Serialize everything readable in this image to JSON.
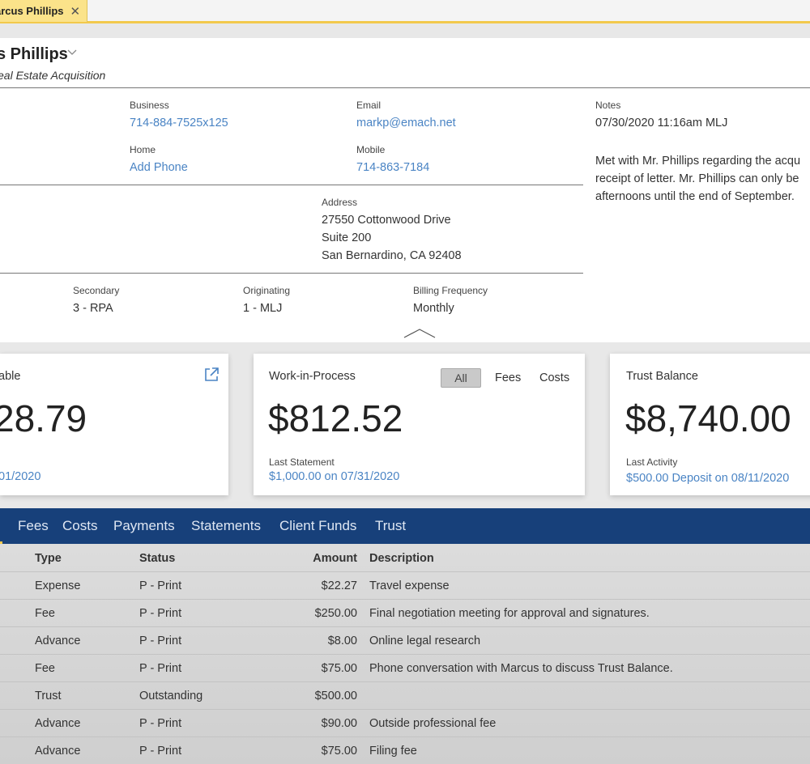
{
  "tab": {
    "label": "arcus Phillips",
    "close": "✕"
  },
  "client": {
    "name": "s Phillips",
    "matter": "eal Estate Acquisition"
  },
  "contact": {
    "business_label": "Business",
    "business_value": "714-884-7525x125",
    "home_label": "Home",
    "home_value": "Add Phone",
    "email_label": "Email",
    "email_value": "markp@emach.net",
    "mobile_label": "Mobile",
    "mobile_value": "714-863-7184",
    "address_label": "Address",
    "address_line1": "27550 Cottonwood Drive",
    "address_line2": "Suite 200",
    "address_line3": "San Bernardino, CA 92408"
  },
  "notes": {
    "label": "Notes",
    "timestamp": "07/30/2020 11:16am MLJ",
    "line1": "Met with Mr. Phillips regarding the acqu",
    "line2": "receipt of letter. Mr. Phillips can only be",
    "line3": "afternoons until the end of September."
  },
  "attorneys": {
    "secondary_label": "Secondary",
    "secondary_value": "3 - RPA",
    "originating_label": "Originating",
    "originating_value": "1 - MLJ",
    "billing_label": "Billing Frequency",
    "billing_value": "Monthly"
  },
  "cards": {
    "receivable": {
      "title": "able",
      "amount": "28.79",
      "link": "01/2020"
    },
    "wip": {
      "title": "Work-in-Process",
      "amount": "$812.52",
      "sublabel": "Last Statement",
      "link": "$1,000.00 on 07/31/2020",
      "seg_all": "All",
      "seg_fees": "Fees",
      "seg_costs": "Costs"
    },
    "trust": {
      "title": "Trust Balance",
      "amount": "$8,740.00",
      "sublabel": "Last Activity",
      "link": "$500.00 Deposit on 08/11/2020"
    }
  },
  "nav": {
    "items": [
      "Fees",
      "Costs",
      "Payments",
      "Statements",
      "Client Funds",
      "Trust"
    ]
  },
  "table": {
    "headers": {
      "type": "Type",
      "status": "Status",
      "amount": "Amount",
      "description": "Description"
    },
    "rows": [
      {
        "type": "Expense",
        "status": "P - Print",
        "amount": "$22.27",
        "description": "Travel expense"
      },
      {
        "type": "Fee",
        "status": "P - Print",
        "amount": "$250.00",
        "description": "Final negotiation meeting for approval and signatures."
      },
      {
        "type": "Advance",
        "status": "P - Print",
        "amount": "$8.00",
        "description": "Online legal research"
      },
      {
        "type": "Fee",
        "status": "P - Print",
        "amount": "$75.00",
        "description": "Phone conversation with Marcus to discuss Trust Balance."
      },
      {
        "type": "Trust",
        "status": "Outstanding",
        "amount": "$500.00",
        "description": ""
      },
      {
        "type": "Advance",
        "status": "P - Print",
        "amount": "$90.00",
        "description": "Outside professional fee"
      },
      {
        "type": "Advance",
        "status": "P - Print",
        "amount": "$75.00",
        "description": "Filing fee"
      }
    ]
  },
  "colors": {
    "accent_yellow": "#f2c94c",
    "nav_blue": "#17407a",
    "link_blue": "#4a84c4"
  }
}
